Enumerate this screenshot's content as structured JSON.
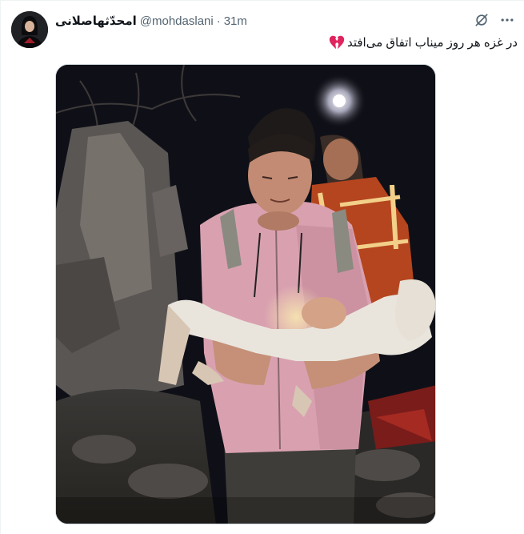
{
  "author": {
    "display_name": "امحدّثهاصلانی",
    "handle": "@mohdaslani",
    "separator": "·",
    "time": "31m"
  },
  "icons": {
    "grok": "grok-icon",
    "more": "more-options-icon",
    "emoji": "broken-heart-icon",
    "avatar": "avatar-image"
  },
  "tweet": {
    "text": "در غزه هر روز میناب اتفاق می‌افتد"
  },
  "media": {
    "kind": "photo",
    "alt": ""
  },
  "colors": {
    "text_primary": "#0f1419",
    "text_secondary": "#536471",
    "border": "#cfd9de",
    "broken_heart": "#e0245e"
  }
}
